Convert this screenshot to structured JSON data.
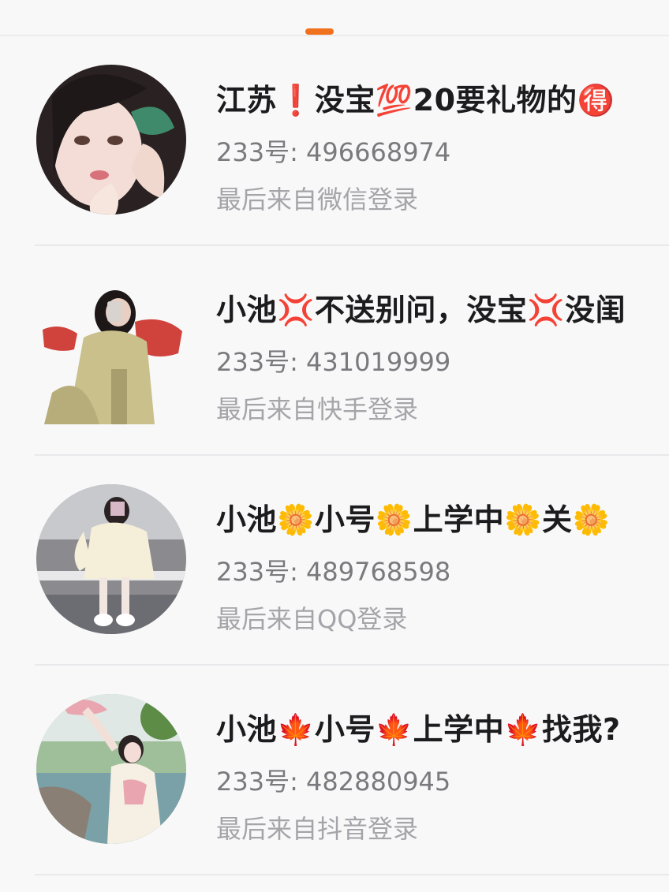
{
  "accounts": [
    {
      "name": "江苏❗没宝💯20要礼物的🉐",
      "uid": "233号: 496668974",
      "login": "最后来自微信登录"
    },
    {
      "name": "小池💢不送别问，没宝💢没闺",
      "uid": "233号: 431019999",
      "login": "最后来自快手登录"
    },
    {
      "name": "小池🌼小号🌼上学中🌼关🌼",
      "uid": "233号: 489768598",
      "login": "最后来自QQ登录"
    },
    {
      "name": "小池🍁小号🍁上学中🍁找我?",
      "uid": "233号: 482880945",
      "login": "最后来自抖音登录"
    }
  ],
  "colors": {
    "accent": "#f0721e",
    "name_text": "#1c1c1e",
    "uid_text": "#7a7a7e",
    "login_text": "#a5a5a9"
  }
}
